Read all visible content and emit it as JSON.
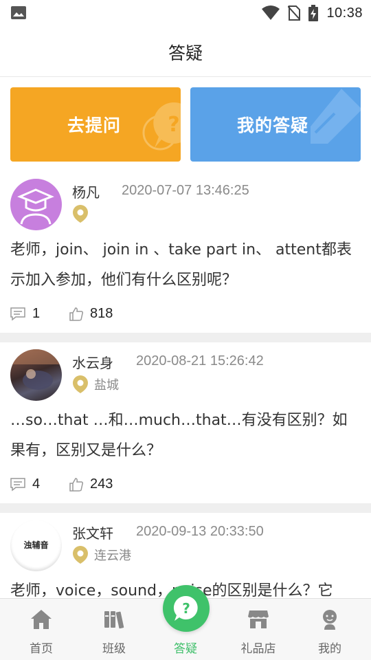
{
  "status_bar": {
    "time": "10:38",
    "left_icon": "image-icon",
    "right_icons": [
      "wifi-icon",
      "no-sim-icon",
      "battery-charging-icon"
    ]
  },
  "header": {
    "title": "答疑"
  },
  "banners": {
    "ask": {
      "label": "去提问",
      "color": "#f5a623",
      "icon": "question-bubble-icon"
    },
    "mine": {
      "label": "我的答疑",
      "color": "#5aa2e8",
      "icon": "pencil-icon"
    }
  },
  "posts": [
    {
      "username": "杨凡",
      "time": "2020-07-07 13:46:25",
      "location": "",
      "content": "老师，join、 join in 、take part in、 attent都表示加入参加，他们有什么区别呢？",
      "comments": "1",
      "likes": "818",
      "avatar": "graduate-avatar"
    },
    {
      "username": "水云身",
      "time": "2020-08-21 15:26:42",
      "location": "盐城",
      "content": "…so…that …和…much…that…有没有区别？如果有，区别又是什么？",
      "comments": "4",
      "likes": "243",
      "avatar": "photo-avatar"
    },
    {
      "username": "张文轩",
      "time": "2020-09-13 20:33:50",
      "location": "连云港",
      "content": "老师，voice，sound，noise的区别是什么？它",
      "avatar": "logo-avatar",
      "avatar_text": "浊辅音"
    }
  ],
  "tabs": [
    {
      "label": "首页",
      "icon": "home-icon"
    },
    {
      "label": "班级",
      "icon": "books-icon"
    },
    {
      "label": "答疑",
      "icon": "question-icon",
      "active": true
    },
    {
      "label": "礼品店",
      "icon": "shop-icon"
    },
    {
      "label": "我的",
      "icon": "person-icon"
    }
  ],
  "colors": {
    "accent": "#3fc26a",
    "location_pin": "#d9bf6a",
    "separator": "#efefef"
  }
}
